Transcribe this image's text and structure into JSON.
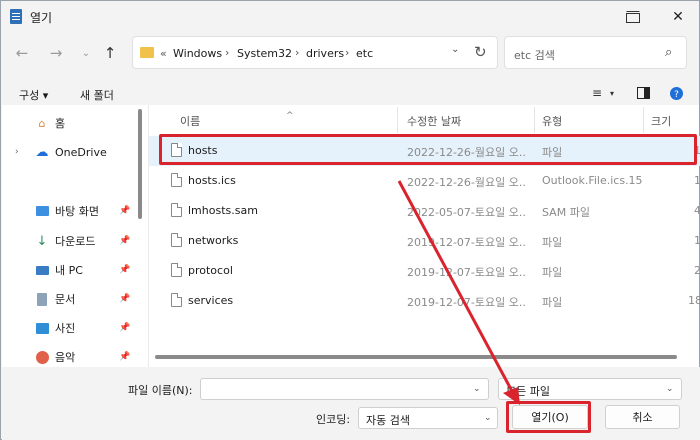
{
  "window": {
    "title": "열기",
    "controls": [
      "new-window",
      "close"
    ]
  },
  "address_bar": {
    "overflow": "«",
    "crumbs": [
      "Windows",
      "System32",
      "drivers",
      "etc"
    ]
  },
  "search": {
    "placeholder": "etc 검색"
  },
  "command_bar": {
    "organize": "구성",
    "new_folder": "새 폴더"
  },
  "sidebar": {
    "items": [
      {
        "label": "홈",
        "icon": "home-icon",
        "pinned": false
      },
      {
        "label": "OneDrive",
        "icon": "cloud-icon",
        "pinned": false
      },
      {
        "label": "바탕 화면",
        "icon": "desktop-icon",
        "pinned": true
      },
      {
        "label": "다운로드",
        "icon": "download-icon",
        "pinned": true
      },
      {
        "label": "내 PC",
        "icon": "pc-icon",
        "pinned": true
      },
      {
        "label": "문서",
        "icon": "document-icon",
        "pinned": true
      },
      {
        "label": "사진",
        "icon": "pictures-icon",
        "pinned": true
      },
      {
        "label": "음악",
        "icon": "music-icon",
        "pinned": true
      }
    ]
  },
  "file_list": {
    "columns": {
      "name": "이름",
      "modified": "수정한 날짜",
      "type": "유형",
      "size": "크기"
    },
    "rows": [
      {
        "name": "hosts",
        "modified": "2022-12-26-월요일 오...",
        "type": "파일",
        "size": "1",
        "selected": true
      },
      {
        "name": "hosts.ics",
        "modified": "2022-12-26-월요일 오...",
        "type": "Outlook.File.ics.15",
        "size": "1",
        "selected": false
      },
      {
        "name": "lmhosts.sam",
        "modified": "2022-05-07-토요일 오...",
        "type": "SAM 파일",
        "size": "4",
        "selected": false
      },
      {
        "name": "networks",
        "modified": "2019-12-07-토요일 오...",
        "type": "파일",
        "size": "1",
        "selected": false
      },
      {
        "name": "protocol",
        "modified": "2019-12-07-토요일 오...",
        "type": "파일",
        "size": "2",
        "selected": false
      },
      {
        "name": "services",
        "modified": "2019-12-07-토요일 오...",
        "type": "파일",
        "size": "18",
        "selected": false
      }
    ]
  },
  "bottom": {
    "filename_label": "파일 이름(N):",
    "filename_value": "",
    "filter_value": "모든 파일",
    "encoding_label": "인코딩:",
    "encoding_value": "자동 검색",
    "open_button": "열기(O)",
    "cancel_button": "취소"
  },
  "colors": {
    "annotation": "#d9232d",
    "selection": "#e5f1fb",
    "folder": "#f0c24b"
  }
}
